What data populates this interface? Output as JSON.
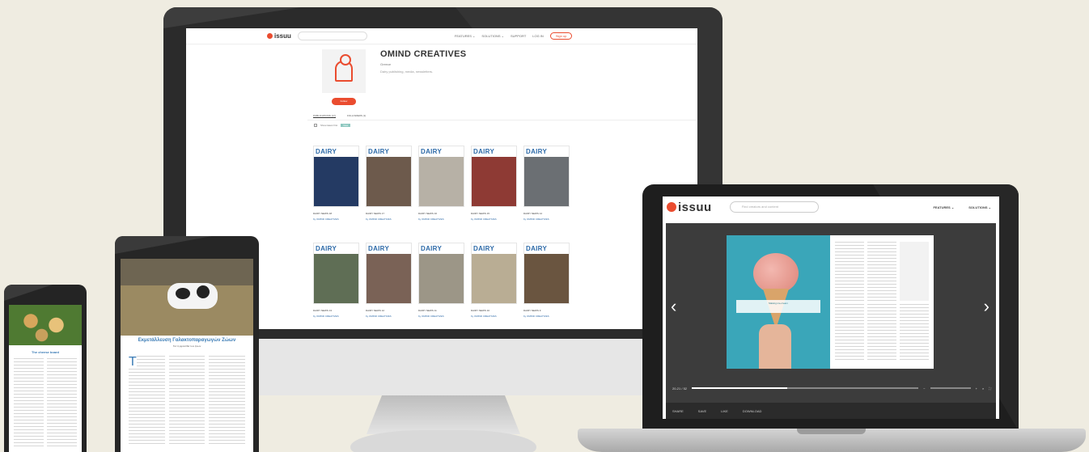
{
  "brand": {
    "logo": "issuu",
    "accent": "#ea4c2f",
    "link": "#2d6aa8"
  },
  "monitor": {
    "nav": {
      "search_placeholder": "",
      "features": "FEATURES ⌄",
      "solutions": "SOLUTIONS ⌄",
      "support": "SUPPORT",
      "login": "LOG IN",
      "signup": "Sign up"
    },
    "profile": {
      "name": "OMIND CREATIVES",
      "country": "Greece",
      "description": "Dairy publishing, media, newsletters.",
      "follow": "Follow"
    },
    "tabs": [
      "PUBLICATIONS (17)",
      "FOLLOWERS (1)"
    ],
    "sort": {
      "label": "Show latest first",
      "tag": "New"
    },
    "publications": [
      {
        "mast": "DAIRY",
        "title": "DAIRY NEWS 18",
        "sub": "by OMIND CREATIVES",
        "art": "#243a63"
      },
      {
        "mast": "DAIRY",
        "title": "DAIRY NEWS 17",
        "sub": "by OMIND CREATIVES",
        "art": "#6d5a4c"
      },
      {
        "mast": "DAIRY",
        "title": "DAIRY NEWS 16",
        "sub": "by OMIND CREATIVES",
        "art": "#b7b1a6"
      },
      {
        "mast": "DAIRY",
        "title": "DAIRY NEWS 15",
        "sub": "by OMIND CREATIVES",
        "art": "#8e3a34"
      },
      {
        "mast": "DAIRY",
        "title": "DAIRY NEWS 14",
        "sub": "by OMIND CREATIVES",
        "art": "#6b6f73"
      },
      {
        "mast": "DAIRY",
        "title": "DAIRY NEWS 13",
        "sub": "by OMIND CREATIVES",
        "art": "#5f6e55"
      },
      {
        "mast": "DAIRY",
        "title": "DAIRY NEWS 12",
        "sub": "by OMIND CREATIVES",
        "art": "#7a6256"
      },
      {
        "mast": "DAIRY",
        "title": "DAIRY NEWS 11",
        "sub": "by OMIND CREATIVES",
        "art": "#9c9687"
      },
      {
        "mast": "DAIRY",
        "title": "DAIRY NEWS 10",
        "sub": "by OMIND CREATIVES",
        "art": "#b9ad94"
      },
      {
        "mast": "DAIRY",
        "title": "DAIRY NEWS 9",
        "sub": "by OMIND CREATIVES",
        "art": "#6a5540"
      }
    ]
  },
  "laptop": {
    "search_placeholder": "Find creators and content",
    "features": "FEATURES ⌄",
    "solutions": "SOLUTIONS ⌄",
    "quote": "Making ice-cream",
    "page_counter": "20-21 / 52",
    "progress": 0.42,
    "actions": [
      "SHARE",
      "SAVE",
      "LIKE",
      "DOWNLOAD"
    ]
  },
  "tablet": {
    "title": "Εκμετάλλευση Γαλακτοπαραγωγών Ζώων",
    "subtitle": "Για τη φροντίδα των ζώων"
  },
  "phone": {
    "title": "The cheese board"
  }
}
